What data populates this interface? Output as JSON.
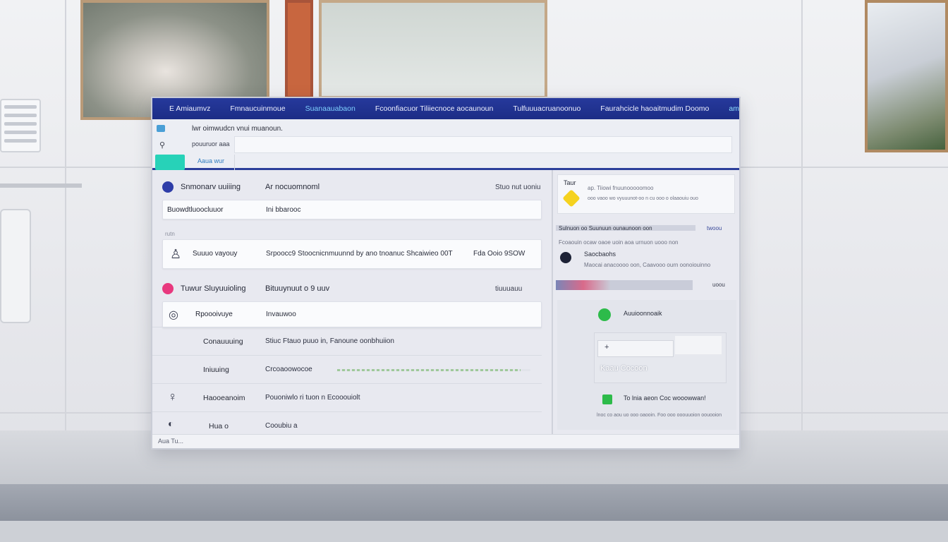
{
  "nav": {
    "tabs": [
      "E Amiaumvz",
      "Fmnaucuinmoue",
      "Suanaauabaon",
      "Fcoonfiacuor Tiliiecnoce aocaunoun",
      "Tulfuuuacruanoonuo",
      "Faurahcicle haoaitmudim Doomo",
      "amuun"
    ],
    "close_glyph": "✕"
  },
  "header": {
    "heading": "lwr oimwudcn vnui muanoun.",
    "field_label": "pouuruor aaa",
    "sub_label": "Aaua wur"
  },
  "left": {
    "rows": [
      {
        "title": "Snmonarv uuiiing",
        "middle": "Ar nocuomnoml",
        "right": "Stuo nut uoniu",
        "dot_color": "#2e3da8"
      },
      {
        "title": "Tuwur Sluyuuioling",
        "middle": "Bituuynuut o 9 uuv",
        "right": "tiuuuauu",
        "dot_color": "#e8387e"
      }
    ],
    "card_1": {
      "left": "Buowdtluoocluuor",
      "mid": "Ini bbarooc"
    },
    "tiny_label": "rutn",
    "card_2": {
      "left": "Suuuo vayouy",
      "mid": "Srpoocc9 Stoocnicnmuunnd by ano tnoanuc Shcaiwieo 00T",
      "right": "Fda Ooio 9SOW"
    },
    "card_3": {
      "left": "Rpoooivuye",
      "mid": "Invauwoo"
    },
    "list": [
      {
        "label": "Conauuuing",
        "value": "Stiuc Ftauo puuo in, Fanoune oonbhuiion"
      },
      {
        "label": "Iniuuing",
        "value": "Crcoaoowocoe",
        "progress": 0.95
      },
      {
        "label": "Haooeanoim",
        "value": "Pouoniwlo ri tuon n Ecooouiolt"
      },
      {
        "label": "Hua o",
        "value": "Cooubiu a"
      }
    ]
  },
  "right": {
    "top_card": {
      "title": "Taur",
      "line1": "ap. Tiiowi fnuunooooomoo",
      "line2": "ooo vaoo wo vyuuunot-oo n cu ooo o olaaouiu ouo"
    },
    "section_1": {
      "title": "Sulnuon oo Suunuun ounaunoon oon",
      "tag": "twoou"
    },
    "item_1": {
      "line": "Fcoaouin ocaw oaoe uoin aoa urnuon uooo non",
      "name": "Saocbaohs",
      "desc": "Maocai anacoooo oon, Caavooo ourn oonoiouinno"
    },
    "section_2": {
      "tag": "uoou"
    },
    "green_label": "Auuioonnoaik",
    "panel_text": "Kaau Cocoon",
    "bottom": {
      "line1": "To lnia aeon Coc wooowwan!",
      "line2": "lnoc co aou uo ooo oaooin. Foo ooo ooouuoion oouooion"
    }
  },
  "footer": {
    "text": "Aua Tu..."
  },
  "colors": {
    "nav": "#26399c",
    "accent_teal": "#27d2b8",
    "divider": "#2c3f9a"
  }
}
